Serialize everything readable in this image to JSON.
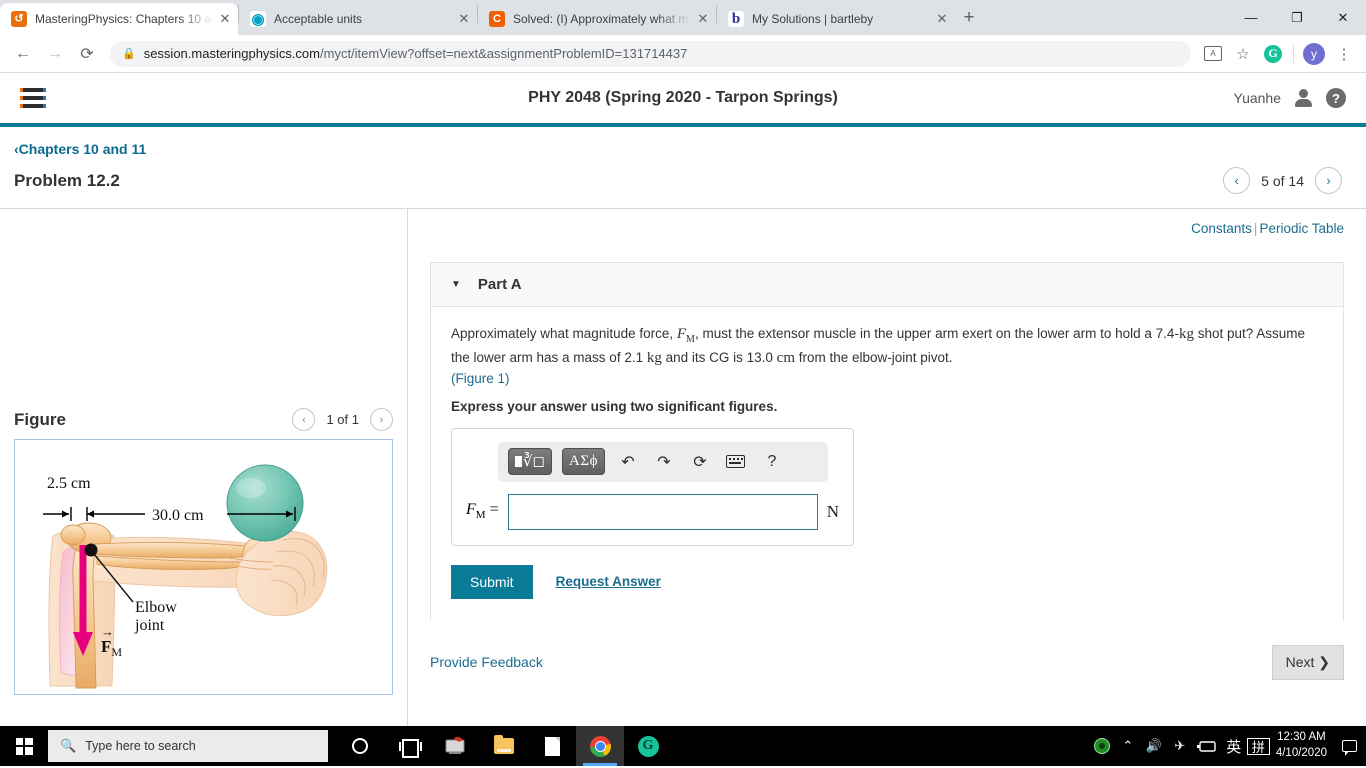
{
  "browser": {
    "tabs": [
      {
        "title": "MasteringPhysics: Chapters 10 an",
        "favicon": "mastering-physics-icon",
        "active": true,
        "close": "✕"
      },
      {
        "title": "Acceptable units",
        "favicon": "pearson-icon",
        "active": false,
        "close": "✕"
      },
      {
        "title": "Solved: (I) Approximately what m",
        "favicon": "chegg-icon",
        "active": false,
        "close": "✕"
      },
      {
        "title": "My Solutions | bartleby",
        "favicon": "bartleby-icon",
        "active": false,
        "close": "✕"
      }
    ],
    "new_tab_label": "+",
    "window_controls": {
      "minimize": "—",
      "maximize": "❐",
      "close": "✕"
    },
    "nav": {
      "back": "←",
      "forward": "→",
      "reload": "⟳"
    },
    "url_domain": "session.masteringphysics.com",
    "url_path": "/myct/itemView?offset=next&assignmentProblemID=131714437",
    "lock_icon": "🔒",
    "toolbar_icons": [
      "translate-icon",
      "bookmark-star-icon",
      "grammarly-icon"
    ],
    "profile_initial": "y",
    "menu_icon": "⋮"
  },
  "site": {
    "menu_label": "hamburger-menu",
    "course_title": "PHY 2048 (Spring 2020 - Tarpon Springs)",
    "user_name": "Yuanhe",
    "help_label": "?",
    "accent_teal": "#0b7c97",
    "link_blue": "#1b6d8f"
  },
  "breadcrumb": {
    "chevron": "‹",
    "label": "Chapters 10 and 11"
  },
  "problem": {
    "title": "Problem 12.2",
    "pager": {
      "prev": "‹",
      "next": "›",
      "label": "5 of 14"
    }
  },
  "figure": {
    "title": "Figure",
    "pager": {
      "prev": "‹",
      "next": "›",
      "label": "1 of 1"
    },
    "labels": {
      "dist_short": "2.5 cm",
      "dist_long": "30.0 cm",
      "elbow_line1": "Elbow",
      "elbow_line2": "joint",
      "force_vector": "F",
      "force_sub": "M"
    },
    "colors": {
      "skin": "#fbdcc0",
      "bone": "#f6cf9c",
      "muscle": "#f7c8d8",
      "ball": "#6fc5b3",
      "arrow": "#e6007e",
      "border": "#a9c4e8"
    }
  },
  "content": {
    "constants_label": "Constants",
    "separator": "|",
    "periodic_table_label": "Periodic Table",
    "part_label": "Part A",
    "caret": "▼",
    "question": {
      "seg1": "Approximately what magnitude force, ",
      "var_f": "F",
      "var_sub": "M",
      "seg2": ", must the extensor muscle in the upper arm exert on the lower arm to hold a 7.4-",
      "unit_kg_1": "kg",
      "seg3": " shot put? Assume the lower arm has a mass of 2.1 ",
      "unit_kg_2": "kg",
      "seg4": " and its CG is 13.0 ",
      "unit_cm": "cm",
      "seg5": " from the elbow-joint pivot."
    },
    "figure_link": "(Figure 1)",
    "instruction": "Express your answer using two significant figures."
  },
  "answer": {
    "toolbar": {
      "sqrt_label": "sqrt-template-icon",
      "greek_label": "ΑΣϕ",
      "undo": "↶",
      "redo": "↷",
      "reset": "⟳",
      "keyboard": "keyboard-icon",
      "help": "?"
    },
    "lhs_var": "F",
    "lhs_sub": "M",
    "equals": "=",
    "value": "",
    "placeholder": "",
    "unit": "N"
  },
  "actions": {
    "submit_label": "Submit",
    "request_answer_label": "Request Answer",
    "provide_feedback_label": "Provide Feedback",
    "next_label": "Next",
    "next_chevron": "❯"
  },
  "taskbar": {
    "start": "windows-logo",
    "search_placeholder": "Type here to search",
    "search_icon": "🔍",
    "apps": [
      {
        "name": "cortana-icon"
      },
      {
        "name": "task-view-icon"
      },
      {
        "name": "mail-icon"
      },
      {
        "name": "file-explorer-icon"
      },
      {
        "name": "document-icon"
      },
      {
        "name": "chrome-icon"
      },
      {
        "name": "grammarly-icon"
      }
    ],
    "tray": {
      "nvidia": "shield-icon",
      "chevron": "⌃",
      "volume": "🔊",
      "network": "✈",
      "battery": "battery-icon",
      "ime_lang": "英",
      "ime_mode": "拼",
      "time": "12:30 AM",
      "date": "4/10/2020",
      "notifications": "notification-icon"
    }
  }
}
